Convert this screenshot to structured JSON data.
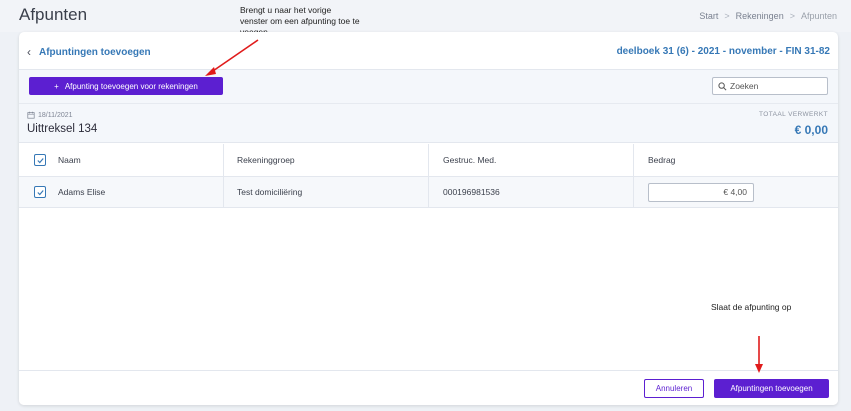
{
  "page": {
    "title": "Afpunten",
    "breadcrumb": [
      "Start",
      "Rekeningen",
      "Afpunten"
    ]
  },
  "annotations": {
    "top": "Brengt u naar het vorige venster om een afpunting toe te voegen",
    "bottom": "Slaat de afpunting op"
  },
  "card": {
    "back_label": "Afpuntingen toevoegen",
    "deelboek": "deelboek 31 (6) - 2021 - november - FIN 31-82"
  },
  "toolbar": {
    "add_label": "Afpunting toevoegen voor rekeningen",
    "search_placeholder": "Zoeken"
  },
  "statement": {
    "date": "18/11/2021",
    "title": "Uittreksel 134",
    "total_label": "TOTAAL VERWERKT",
    "total_value": "€ 0,00"
  },
  "table": {
    "headers": [
      "Naam",
      "Rekeninggroep",
      "Gestruc. Med.",
      "Bedrag"
    ],
    "rows": [
      {
        "naam": "Adams Elise",
        "groep": "Test domiciliëring",
        "mededeling": "000196981536",
        "bedrag": "€ 4,00"
      }
    ]
  },
  "footer": {
    "cancel_label": "Annuleren",
    "confirm_label": "Afpuntingen toevoegen"
  },
  "colors": {
    "primary": "#5c1fd1",
    "link": "#3678b6",
    "annotation_arrow": "#e01b1b"
  }
}
